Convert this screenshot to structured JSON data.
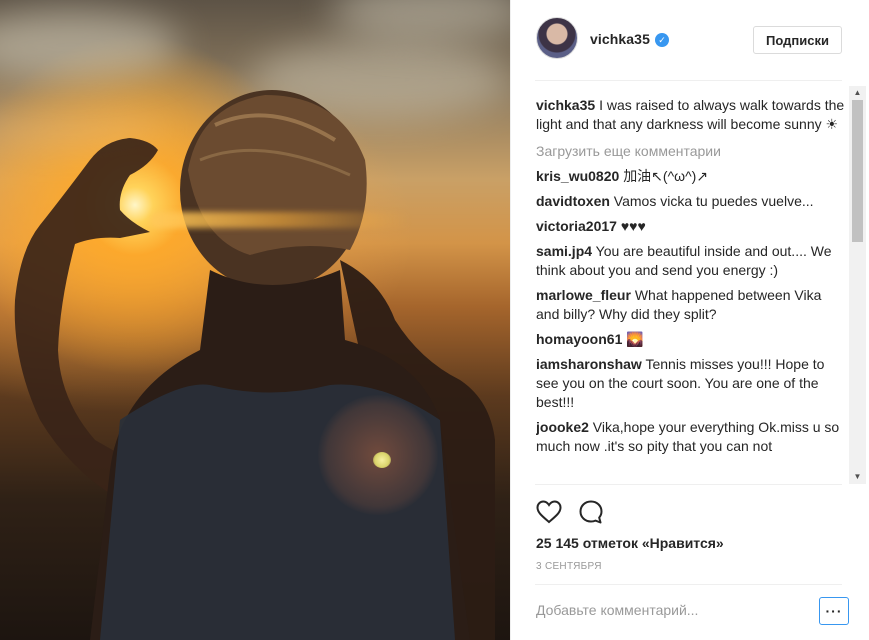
{
  "photo": {
    "alt_icon": "sunset-photo"
  },
  "header": {
    "username": "vichka35",
    "verified_icon": "check-icon",
    "follow_label": "Подписки"
  },
  "caption": {
    "user": "vichka35",
    "text": "I was raised to always walk towards the light and that any darkness will become sunny ☀"
  },
  "load_more": "Загрузить еще комментарии",
  "comments": [
    {
      "user": "kris_wu0820",
      "text": "加油↖(^ω^)↗"
    },
    {
      "user": "davidtoxen",
      "text": "Vamos vicka tu puedes vuelve..."
    },
    {
      "user": "victoria2017",
      "text": "♥♥♥"
    },
    {
      "user": "sami.jp4",
      "text": "You are beautiful inside and out.... We think about you and send you energy :)"
    },
    {
      "user": "marlowe_fleur",
      "text": "What happened between Vika and billy? Why did they split?"
    },
    {
      "user": "homayoon61",
      "text": "🌄"
    },
    {
      "user": "iamsharonshaw",
      "text": "Tennis misses you!!! Hope to see you on the court soon. You are one of the best!!!"
    },
    {
      "user": "joooke2",
      "text": "Vika,hope your everything Ok.miss u so much now .it's so pity that you can not"
    }
  ],
  "actions": {
    "like_icon": "heart-icon",
    "comment_icon": "comment-icon"
  },
  "likes": "25 145 отметок «Нравится»",
  "date": "3 СЕНТЯБРЯ",
  "add_comment": {
    "placeholder": "Добавьте комментарий..."
  },
  "more_label": "···",
  "colors": {
    "accent": "#3897f0",
    "text": "#262626",
    "muted": "#999999"
  }
}
